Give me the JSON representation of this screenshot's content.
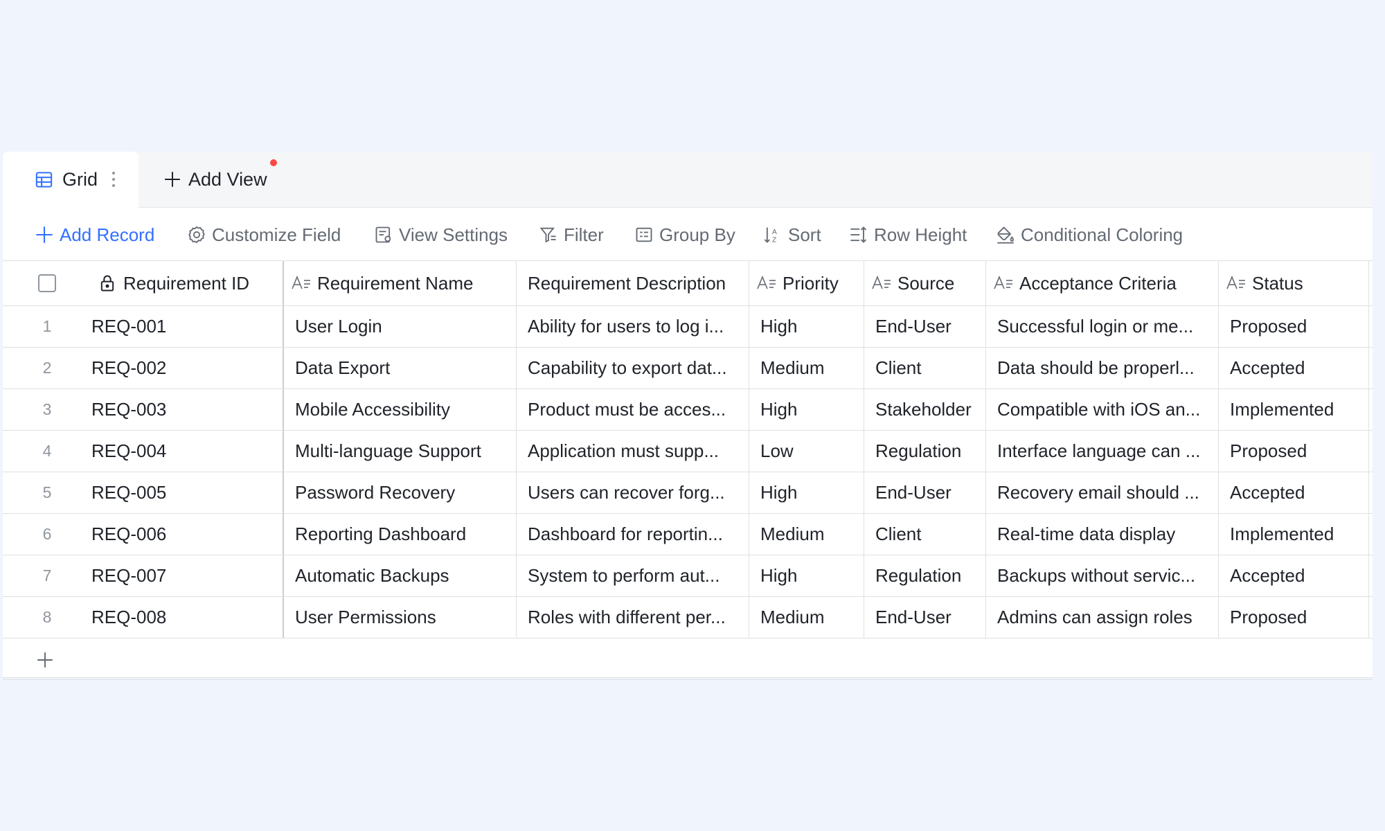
{
  "tabs": {
    "grid_label": "Grid",
    "add_view_label": "Add View"
  },
  "toolbar": {
    "add_record": "Add Record",
    "customize_field": "Customize Field",
    "view_settings": "View Settings",
    "filter": "Filter",
    "group_by": "Group By",
    "sort": "Sort",
    "row_height": "Row Height",
    "conditional_coloring": "Conditional Coloring"
  },
  "columns": [
    "Requirement ID",
    "Requirement Name",
    "Requirement Description",
    "Priority",
    "Source",
    "Acceptance Criteria",
    "Status"
  ],
  "rows": [
    {
      "num": "1",
      "id": "REQ-001",
      "name": "User Login",
      "desc": "Ability for users to log i...",
      "priority": "High",
      "source": "End-User",
      "criteria": "Successful login or me...",
      "status": "Proposed"
    },
    {
      "num": "2",
      "id": "REQ-002",
      "name": "Data Export",
      "desc": "Capability to export dat...",
      "priority": "Medium",
      "source": "Client",
      "criteria": "Data should be properl...",
      "status": "Accepted"
    },
    {
      "num": "3",
      "id": "REQ-003",
      "name": "Mobile Accessibility",
      "desc": "Product must be acces...",
      "priority": "High",
      "source": "Stakeholder",
      "criteria": "Compatible with iOS an...",
      "status": "Implemented"
    },
    {
      "num": "4",
      "id": "REQ-004",
      "name": "Multi-language Support",
      "desc": "Application must supp...",
      "priority": "Low",
      "source": "Regulation",
      "criteria": "Interface language can ...",
      "status": "Proposed"
    },
    {
      "num": "5",
      "id": "REQ-005",
      "name": "Password Recovery",
      "desc": "Users can recover forg...",
      "priority": "High",
      "source": "End-User",
      "criteria": "Recovery email should ...",
      "status": "Accepted"
    },
    {
      "num": "6",
      "id": "REQ-006",
      "name": "Reporting Dashboard",
      "desc": "Dashboard for reportin...",
      "priority": "Medium",
      "source": "Client",
      "criteria": "Real-time data display",
      "status": "Implemented"
    },
    {
      "num": "7",
      "id": "REQ-007",
      "name": "Automatic Backups",
      "desc": "System to perform aut...",
      "priority": "High",
      "source": "Regulation",
      "criteria": "Backups without servic...",
      "status": "Accepted"
    },
    {
      "num": "8",
      "id": "REQ-008",
      "name": "User Permissions",
      "desc": "Roles with different per...",
      "priority": "Medium",
      "source": "End-User",
      "criteria": "Admins can assign roles",
      "status": "Proposed"
    }
  ],
  "colors": {
    "accent": "#3370ff",
    "notification_dot": "#f54a45",
    "page_background": "#f0f4fd"
  }
}
